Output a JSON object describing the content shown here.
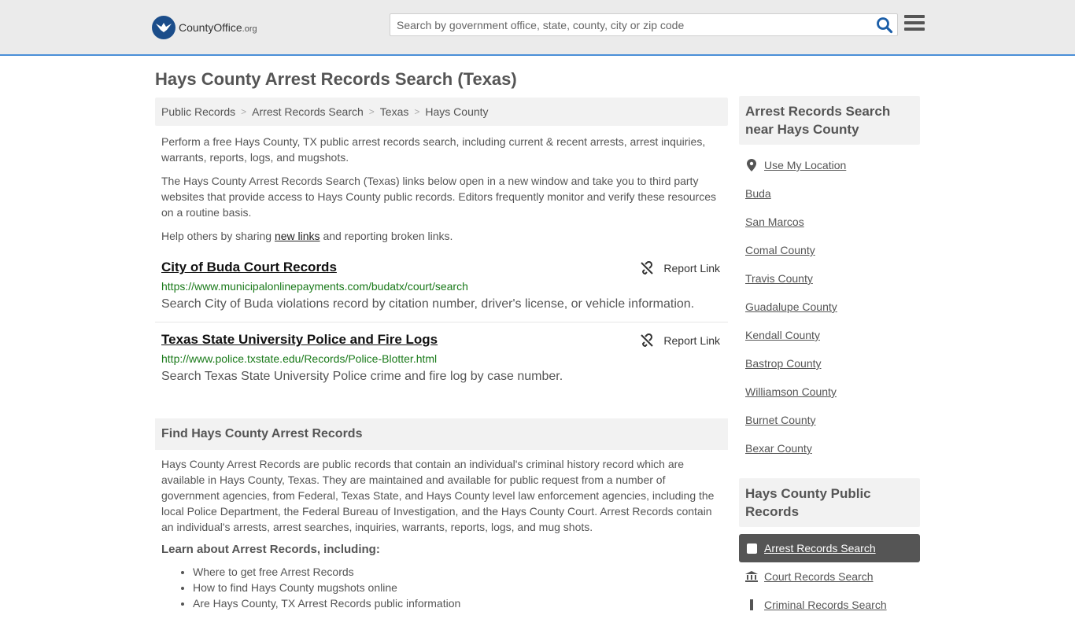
{
  "header": {
    "logo_main": "CountyOffice",
    "logo_suffix": ".org",
    "search_placeholder": "Search by government office, state, county, city or zip code"
  },
  "page_title": "Hays County Arrest Records Search (Texas)",
  "breadcrumb": [
    "Public Records",
    "Arrest Records Search",
    "Texas",
    "Hays County"
  ],
  "intro": {
    "p1": "Perform a free Hays County, TX public arrest records search, including current & recent arrests, arrest inquiries, warrants, reports, logs, and mugshots.",
    "p2": "The Hays County Arrest Records Search (Texas) links below open in a new window and take you to third party websites that provide access to Hays County public records. Editors frequently monitor and verify these resources on a routine basis.",
    "p3_before": "Help others by sharing ",
    "p3_link": "new links",
    "p3_after": " and reporting broken links."
  },
  "records": [
    {
      "title": "City of Buda Court Records",
      "url": "https://www.municipalonlinepayments.com/budatx/court/search",
      "description": "Search City of Buda violations record by citation number, driver's license, or vehicle information.",
      "report_label": "Report Link"
    },
    {
      "title": "Texas State University Police and Fire Logs",
      "url": "http://www.police.txstate.edu/Records/Police-Blotter.html",
      "description": "Search Texas State University Police crime and fire log by case number.",
      "report_label": "Report Link"
    }
  ],
  "find_section": {
    "heading": "Find Hays County Arrest Records",
    "body": "Hays County Arrest Records are public records that contain an individual's criminal history record which are available in Hays County, Texas. They are maintained and available for public request from a number of government agencies, from Federal, Texas State, and Hays County level law enforcement agencies, including the local Police Department, the Federal Bureau of Investigation, and the Hays County Court. Arrest Records contain an individual's arrests, arrest searches, inquiries, warrants, reports, logs, and mug shots.",
    "learn_heading": "Learn about Arrest Records, including:",
    "learn_items": [
      "Where to get free Arrest Records",
      "How to find Hays County mugshots online",
      "Are Hays County, TX Arrest Records public information"
    ]
  },
  "sidebar": {
    "nearby_heading": "Arrest Records Search near Hays County",
    "use_location": "Use My Location",
    "nearby": [
      "Buda",
      "San Marcos",
      "Comal County",
      "Travis County",
      "Guadalupe County",
      "Kendall County",
      "Bastrop County",
      "Williamson County",
      "Burnet County",
      "Bexar County"
    ],
    "public_heading": "Hays County Public Records",
    "public_items": [
      "Arrest Records Search",
      "Court Records Search",
      "Criminal Records Search"
    ]
  },
  "colors": {
    "accent_border": "#4a8fd8",
    "url_green": "#1a7a1a",
    "active_bg": "#555555"
  }
}
